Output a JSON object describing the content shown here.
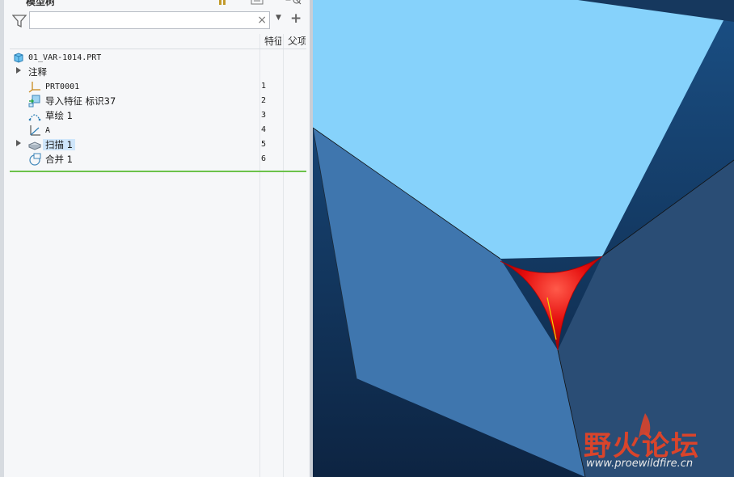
{
  "panel": {
    "title": "模型树",
    "search": {
      "value": "",
      "placeholder": "",
      "clear_glyph": "×"
    },
    "columns": [
      "特征",
      "父项"
    ]
  },
  "tree": {
    "root": {
      "label": "01_VAR-1014.PRT",
      "icon": "part-icon"
    },
    "items": [
      {
        "label": "注释",
        "number": "",
        "expandable": true,
        "icon": ""
      },
      {
        "label": "PRT0001",
        "number": "1",
        "expandable": false,
        "icon": "coordinate-system-icon"
      },
      {
        "label": "导入特征 标识37",
        "number": "2",
        "expandable": false,
        "icon": "import-feature-icon"
      },
      {
        "label": "草绘 1",
        "number": "3",
        "expandable": false,
        "icon": "sketch-icon"
      },
      {
        "label": "A",
        "number": "4",
        "expandable": false,
        "icon": "datum-plane-icon"
      },
      {
        "label": "扫描 1",
        "number": "5",
        "expandable": true,
        "selected": true,
        "icon": "sweep-icon"
      },
      {
        "label": "合并 1",
        "number": "6",
        "expandable": false,
        "icon": "merge-icon"
      }
    ]
  },
  "watermark": {
    "brand": "野火论坛",
    "url": "www.proewildfire.cn"
  },
  "colors": {
    "viewport_bg": "#16385e",
    "top_face": "#86d2fb",
    "left_face": "#3f76ae",
    "right_face": "#2a4d75",
    "sweep_red": "#e00000",
    "insert_line": "#6cc24a",
    "watermark_red": "#d9442b"
  }
}
